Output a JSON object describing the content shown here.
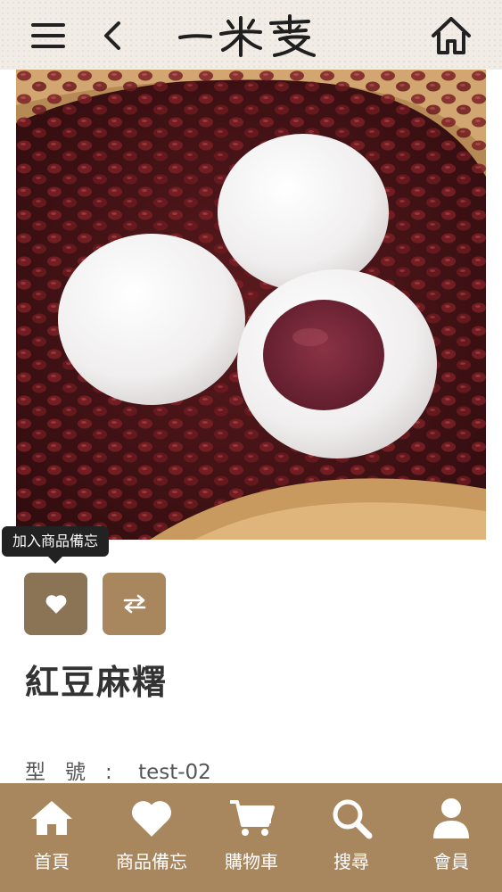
{
  "header": {
    "menu_icon": "hamburger-menu-icon",
    "back_icon": "chevron-left-icon",
    "logo_text": "一米麥",
    "home_icon": "home-icon",
    "background": "#f1ece5"
  },
  "product": {
    "image_alt": "紅豆麻糬",
    "tooltip": "加入商品備忘",
    "wishlist_icon": "heart-icon",
    "compare_icon": "swap-arrows-icon",
    "title": "紅豆麻糬",
    "model_label": "型號:",
    "model_value": "test-02"
  },
  "bottom_nav": {
    "items": [
      {
        "label": "首頁",
        "icon": "home-icon"
      },
      {
        "label": "商品備忘",
        "icon": "heart-icon"
      },
      {
        "label": "購物車",
        "icon": "shopping-cart-icon"
      },
      {
        "label": "搜尋",
        "icon": "search-icon"
      },
      {
        "label": "會員",
        "icon": "user-icon"
      }
    ]
  },
  "colors": {
    "accent": "#a8875f",
    "accent_dark": "#8b7355",
    "tooltip": "#222222"
  }
}
